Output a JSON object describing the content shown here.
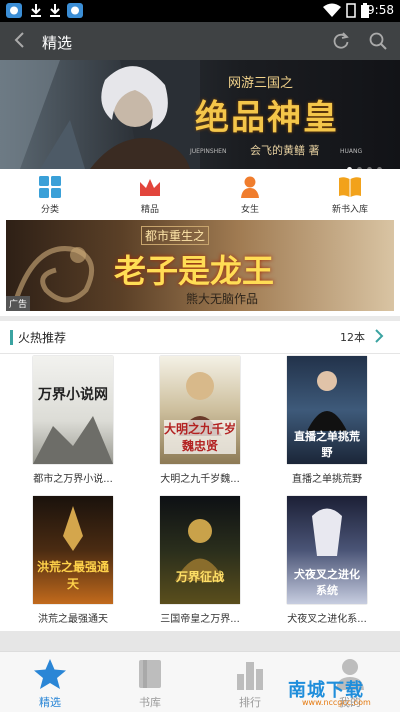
{
  "status_bar": {
    "time": "9:58"
  },
  "app_bar": {
    "title": "精选"
  },
  "banner": {
    "series": "网游三国之",
    "title": "绝品神皇",
    "author": "会飞的黄鳝 著",
    "pinyin_left": "JUEPINSHEN",
    "pinyin_right": "HUANG",
    "page_count": 4,
    "active_page": 1
  },
  "categories": [
    {
      "label": "分类",
      "icon": "grid-icon",
      "color": "#3aa0d8"
    },
    {
      "label": "精品",
      "icon": "crown-icon",
      "color": "#e2453c"
    },
    {
      "label": "女生",
      "icon": "female-icon",
      "color": "#f07d2d"
    },
    {
      "label": "新书入库",
      "icon": "book-icon",
      "color": "#f2a21b"
    }
  ],
  "ad": {
    "subtitle": "都市重生之",
    "title": "老子是龙王",
    "author": "熊大无脑作品",
    "label": "广告"
  },
  "section": {
    "title": "火热推荐",
    "count": "12本",
    "books": [
      {
        "title": "都市之万界小说...",
        "cover_text": "万界小说网"
      },
      {
        "title": "大明之九千岁魏...",
        "cover_text": "大明之九千岁魏忠贤"
      },
      {
        "title": "直播之单挑荒野",
        "cover_text": "直播之单挑荒野"
      },
      {
        "title": "洪荒之最强通天",
        "cover_text": "洪荒之最强通天"
      },
      {
        "title": "三国帝皇之万界...",
        "cover_text": "万界征战"
      },
      {
        "title": "犬夜叉之进化系...",
        "cover_text": "犬夜叉之进化系统"
      }
    ]
  },
  "bottom_nav": [
    {
      "label": "精选",
      "icon": "star-icon",
      "active": true
    },
    {
      "label": "书库",
      "icon": "bookshelf-icon",
      "active": false
    },
    {
      "label": "排行",
      "icon": "bar-chart-icon",
      "active": false
    },
    {
      "label": "我的",
      "icon": "user-icon",
      "active": false
    }
  ],
  "watermark": {
    "main": "南城下载",
    "sub": "www.nccgcc.com"
  }
}
